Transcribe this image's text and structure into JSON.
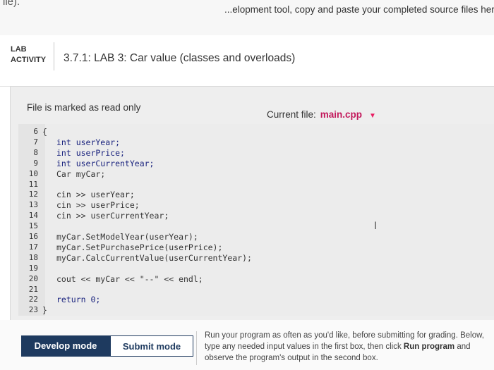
{
  "top": {
    "left_fragment": "ile).",
    "right_text": "...elopment tool, copy and paste your completed source files here t"
  },
  "lab": {
    "tag_line1": "LAB",
    "tag_line2": "ACTIVITY",
    "title": "3.7.1: LAB 3: Car value (classes and overloads)"
  },
  "editor": {
    "readonly_label": "File is marked as read only",
    "current_file_label": "Current file:",
    "current_file_name": "main.cpp",
    "lines": [
      {
        "n": "6",
        "code": "{"
      },
      {
        "n": "7",
        "code": "int userYear;"
      },
      {
        "n": "8",
        "code": "int userPrice;"
      },
      {
        "n": "9",
        "code": "int userCurrentYear;"
      },
      {
        "n": "10",
        "code": "Car myCar;"
      },
      {
        "n": "11",
        "code": ""
      },
      {
        "n": "12",
        "code": "cin >> userYear;"
      },
      {
        "n": "13",
        "code": "cin >> userPrice;"
      },
      {
        "n": "14",
        "code": "cin >> userCurrentYear;"
      },
      {
        "n": "15",
        "code": ""
      },
      {
        "n": "16",
        "code": "myCar.SetModelYear(userYear);"
      },
      {
        "n": "17",
        "code": "myCar.SetPurchasePrice(userPrice);"
      },
      {
        "n": "18",
        "code": "myCar.CalcCurrentValue(userCurrentYear);"
      },
      {
        "n": "19",
        "code": ""
      },
      {
        "n": "20",
        "code": "cout << myCar << \"--\" << endl;"
      },
      {
        "n": "21",
        "code": ""
      },
      {
        "n": "22",
        "code": "return 0;"
      },
      {
        "n": "23",
        "code": "}"
      }
    ]
  },
  "modes": {
    "develop": "Develop mode",
    "submit": "Submit mode"
  },
  "instructions": {
    "part1": "Run your program as often as you'd like, before submitting for grading. Below, type any needed input values in the first box, then click ",
    "bold": "Run program",
    "part2": " and observe the program's output in the second box."
  }
}
